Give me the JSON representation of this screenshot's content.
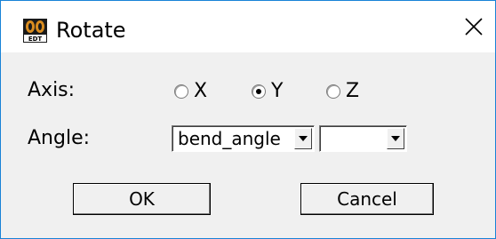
{
  "window": {
    "title": "Rotate",
    "app_icon": "edt-app-icon",
    "close_icon": "close-icon"
  },
  "axis": {
    "label": "Axis:",
    "options": [
      {
        "label": "X",
        "checked": false
      },
      {
        "label": "Y",
        "checked": true
      },
      {
        "label": "Z",
        "checked": false
      }
    ]
  },
  "angle": {
    "label": "Angle:",
    "value_combo": "bend_angle",
    "unit_combo": ""
  },
  "buttons": {
    "ok": "OK",
    "cancel": "Cancel"
  },
  "colors": {
    "window_border": "#1883d7",
    "client_bg": "#f0f0f0"
  }
}
